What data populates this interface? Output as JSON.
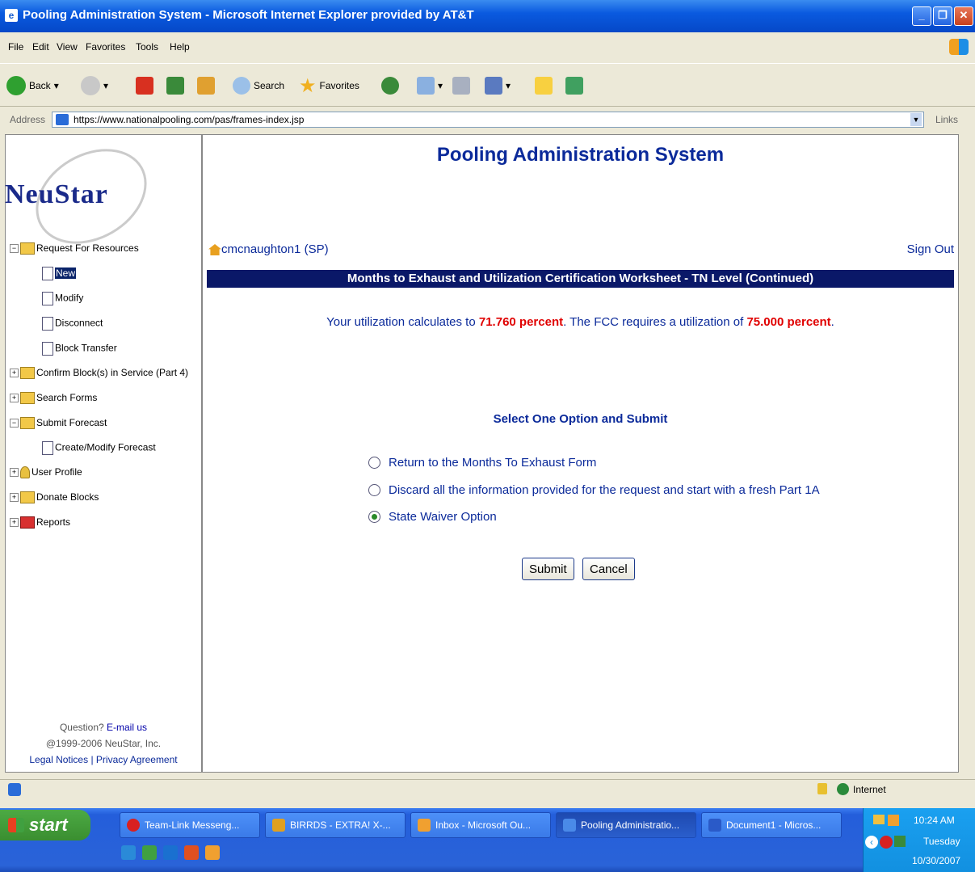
{
  "window": {
    "title": "Pooling Administration System - Microsoft Internet Explorer provided by AT&T"
  },
  "menu": [
    "File",
    "Edit",
    "View",
    "Favorites",
    "Tools",
    "Help"
  ],
  "toolbar": {
    "back": "Back",
    "search": "Search",
    "favorites": "Favorites"
  },
  "address": {
    "label": "Address",
    "url": "https://www.nationalpooling.com/pas/frames-index.jsp",
    "links": "Links"
  },
  "sidebar": {
    "logo": "NeuStar",
    "tree": {
      "request": "Request For Resources",
      "new": "New",
      "modify": "Modify",
      "disconnect": "Disconnect",
      "block_transfer": "Block Transfer",
      "confirm": "Confirm Block(s) in Service (Part 4)",
      "search_forms": "Search Forms",
      "submit_forecast": "Submit Forecast",
      "create_modify": "Create/Modify Forecast",
      "user_profile": "User Profile",
      "donate": "Donate Blocks",
      "reports": "Reports"
    },
    "footer": {
      "question": "Question?",
      "email": "E-mail us",
      "copyright": "@1999-2006 NeuStar, Inc.",
      "legal": "Legal Notices",
      "sep": "|",
      "privacy": "Privacy Agreement"
    }
  },
  "main": {
    "title": "Pooling Administration System",
    "user": "cmcnaughton1 (SP)",
    "signout": "Sign Out",
    "banner": "Months to Exhaust and Utilization Certification Worksheet - TN Level (Continued)",
    "util_pre": "Your utilization calculates to",
    "util_value": "71.760 percent",
    "util_mid": ". The FCC requires a utilization of",
    "util_req": "75.000 percent",
    "util_end": ".",
    "select_heading": "Select One Option and Submit",
    "options": [
      "Return to the Months To Exhaust Form",
      "Discard all the information provided for the request and start with a fresh Part 1A",
      "State Waiver Option"
    ],
    "selected_option": 2,
    "submit": "Submit",
    "cancel": "Cancel"
  },
  "status": {
    "zone": "Internet"
  },
  "taskbar": {
    "start": "start",
    "tasks": [
      "Team-Link Messeng...",
      "BIRRDS - EXTRA! X-...",
      "Inbox - Microsoft Ou...",
      "Pooling Administratio...",
      "Document1 - Micros..."
    ],
    "time": "10:24 AM",
    "day": "Tuesday",
    "date": "10/30/2007"
  }
}
